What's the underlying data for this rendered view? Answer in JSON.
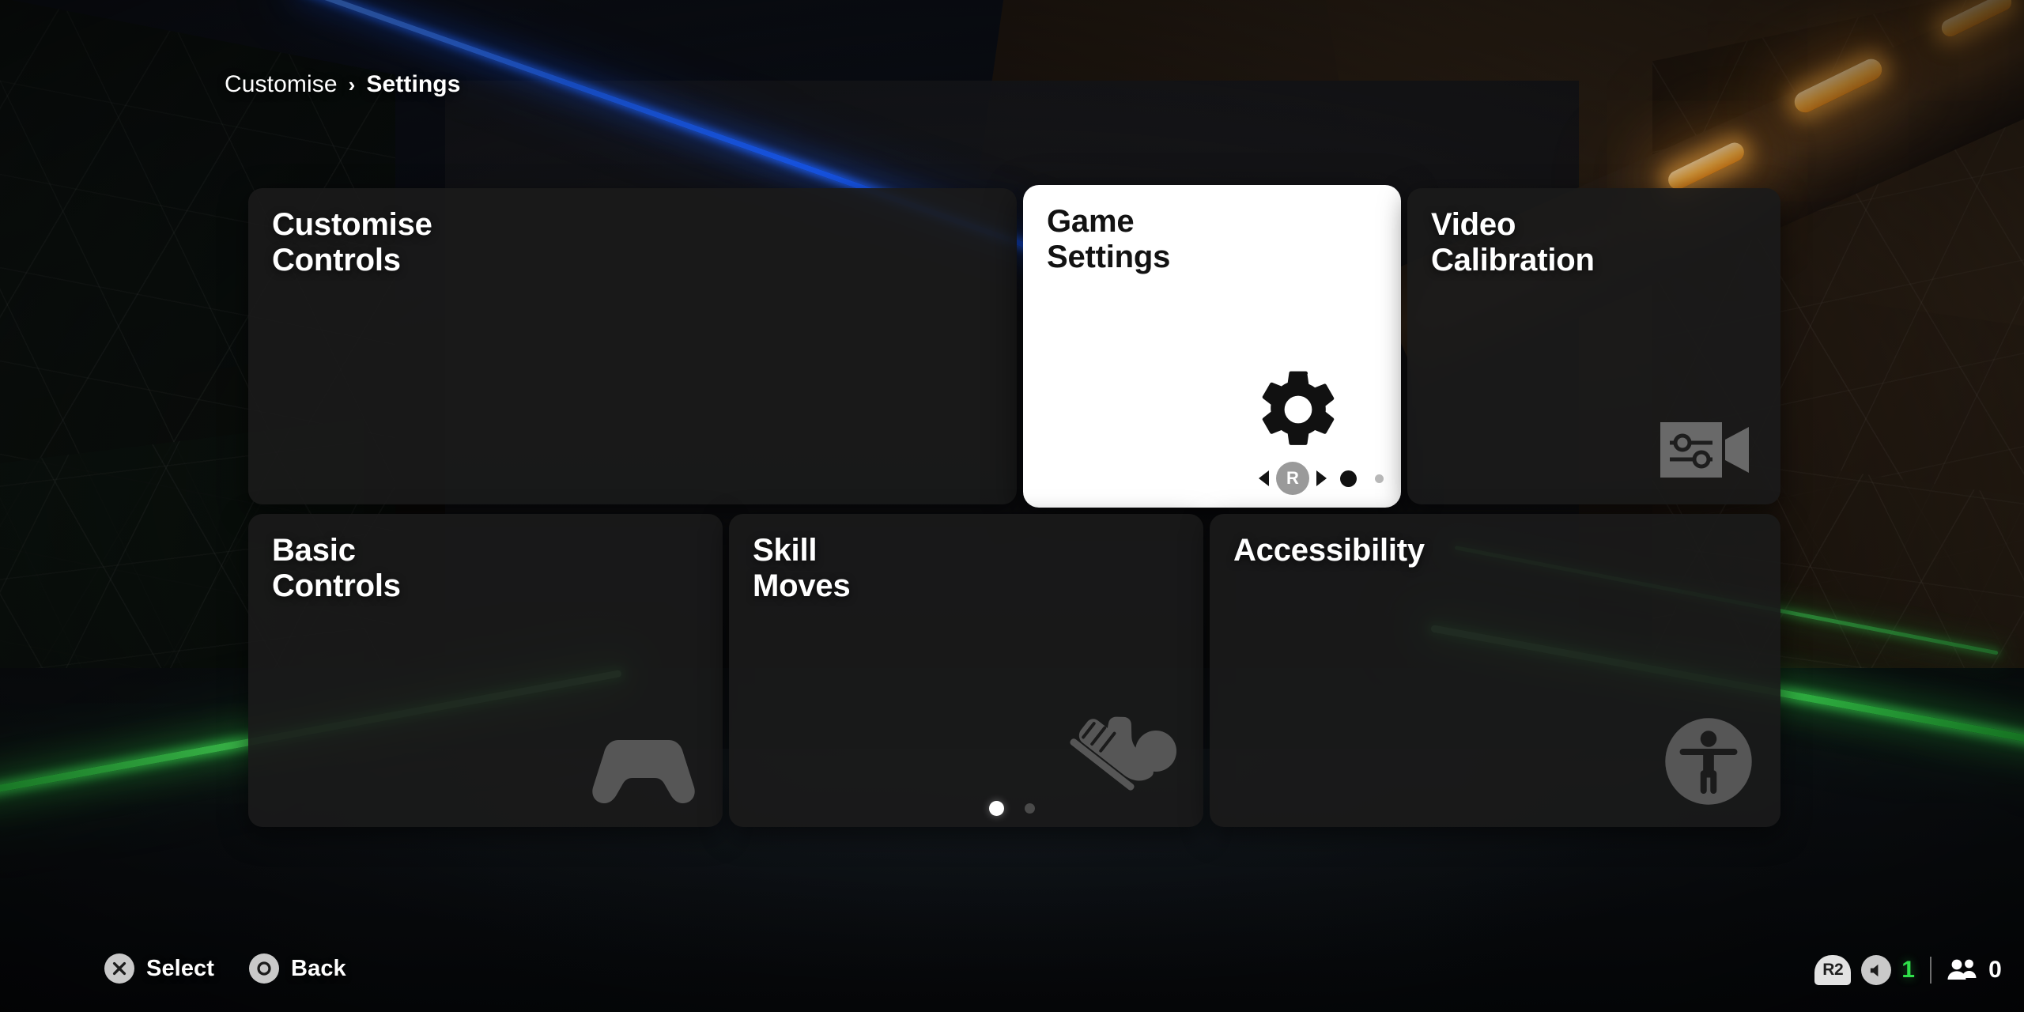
{
  "breadcrumb": {
    "root": "Customise",
    "separator": "›",
    "current": "Settings"
  },
  "colors": {
    "selected_card_bg": "#ffffff",
    "card_bg": "#1a1a1a",
    "card_title": "#ffffff",
    "selected_card_title": "#121212",
    "neon_green": "#3fdd55",
    "neon_blue": "#1c5ff2",
    "lamp_orange": "#ffb545",
    "volume_count": "#2fe04a"
  },
  "grid": {
    "row1": [
      {
        "title": "Customise\nControls",
        "icon": "none",
        "selected": false
      },
      {
        "title": "Game\nSettings",
        "icon": "gear-icon",
        "selected": true
      },
      {
        "title": "Video\nCalibration",
        "icon": "video-calibration-icon",
        "selected": false
      }
    ],
    "row2": [
      {
        "title": "Basic\nControls",
        "icon": "gamepad-icon",
        "selected": false
      },
      {
        "title": "Skill\nMoves",
        "icon": "boot-and-ball-icon",
        "selected": false
      },
      {
        "title": "Accessibility",
        "icon": "accessibility-icon",
        "selected": false
      }
    ]
  },
  "card_pager": {
    "left_arrow": "chevron-left-icon",
    "button_label": "R",
    "right_arrow": "chevron-right-icon",
    "dots": [
      {
        "state": "active"
      },
      {
        "state": "idle"
      }
    ]
  },
  "page_dots": [
    {
      "state": "active"
    },
    {
      "state": "idle"
    }
  ],
  "action_bar": [
    {
      "icon": "cross-button-icon",
      "label": "Select"
    },
    {
      "icon": "circle-button-icon",
      "label": "Back"
    }
  ],
  "hud": {
    "shoulder_button": "R2",
    "volume_icon": "volume-icon",
    "volume_count": "1",
    "party_icon": "party-members-icon",
    "party_count": "0"
  }
}
